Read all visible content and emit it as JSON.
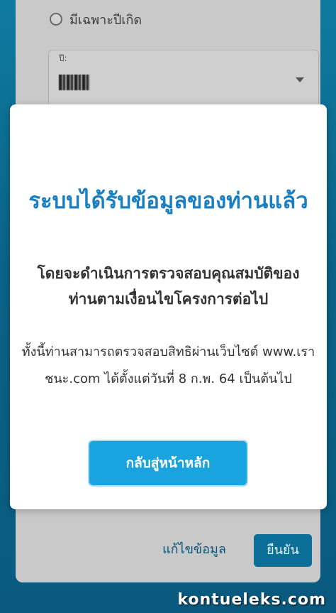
{
  "background_form": {
    "radio_options": [
      "มีเฉพาะปีเกิด"
    ],
    "year_field": {
      "label": "ปี:",
      "value": ""
    },
    "edit_label": "แก้ไขข้อมูล",
    "confirm_label": "ยืนยัน"
  },
  "modal": {
    "title": "ระบบได้รับข้อมูลของท่านแล้ว",
    "subtitle": "โดยจะดำเนินการตรวจสอบคุณสมบัติของท่านตามเงื่อนไขโครงการต่อไป",
    "body": "ทั้งนี้ท่านสามารถตรวจสอบสิทธิผ่านเว็บไซต์ www.เราชนะ.com ได้ตั้งแต่วันที่ 8 ก.พ. 64 เป็นต้นไป",
    "button_label": "กลับสู่หน้าหลัก"
  },
  "watermark": "kontueleks.com",
  "colors": {
    "accent_blue": "#1a7ec2",
    "button_blue": "#1aa4df",
    "background_teal": "#0b6287"
  }
}
